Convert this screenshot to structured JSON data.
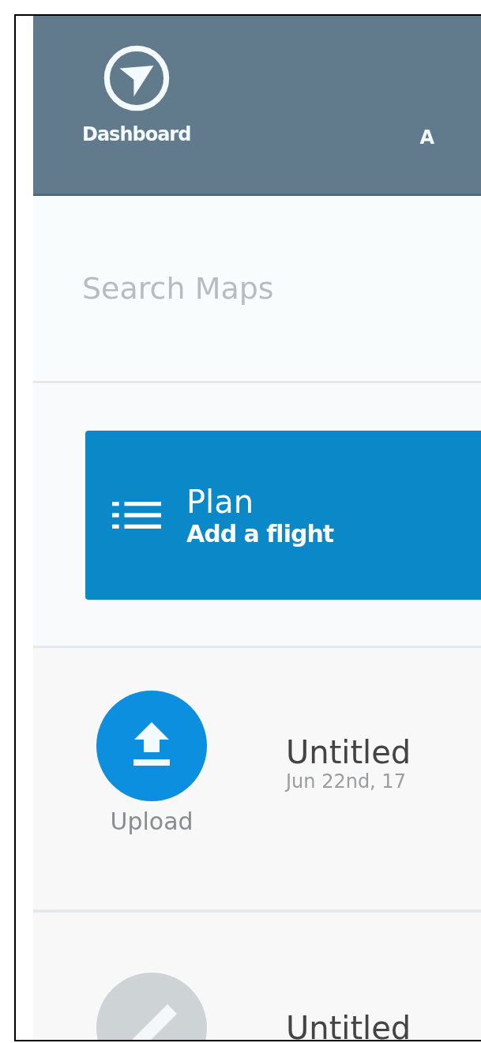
{
  "nav": {
    "items": [
      {
        "label": "Dashboard",
        "kind": "dashboard"
      },
      {
        "label": "A",
        "kind": "other"
      }
    ]
  },
  "search": {
    "placeholder": "Search Maps"
  },
  "plan_card": {
    "title": "Plan",
    "subtitle": "Add a flight"
  },
  "maps": [
    {
      "kind": "upload",
      "action_label": "Upload",
      "title": "Untitled",
      "date": "Jun 22nd, 17"
    },
    {
      "kind": "edit",
      "title": "Untitled"
    }
  ]
}
